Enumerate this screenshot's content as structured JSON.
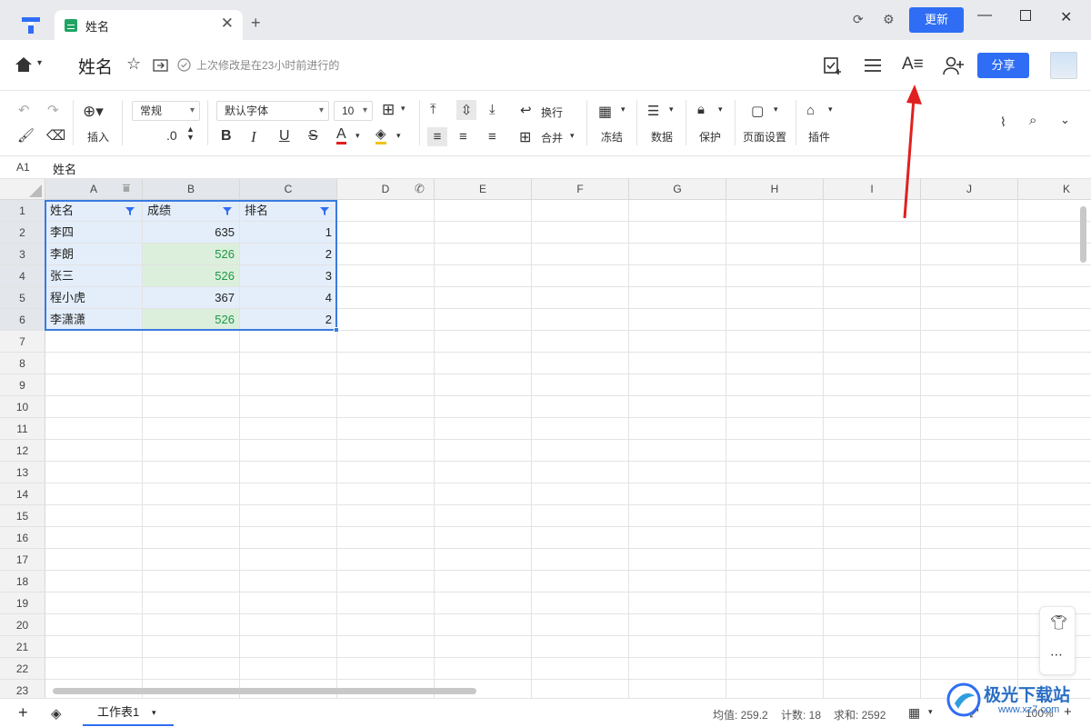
{
  "titlebar": {
    "tab_title": "姓名",
    "update_label": "更新"
  },
  "header": {
    "doc_title": "姓名",
    "save_status": "上次修改是在23小时前进行的",
    "share_label": "分享"
  },
  "toolbar": {
    "insert": "插入",
    "number_format": "常规",
    "decimal": ".0",
    "font": "默认字体",
    "size": "10",
    "bold": "B",
    "italic": "I",
    "underline": "U",
    "strike": "S",
    "fontcolor": "A",
    "wrap": "换行",
    "merge": "合并",
    "freeze": "冻结",
    "data": "数据",
    "protect": "保护",
    "page_setup": "页面设置",
    "plugin": "插件"
  },
  "formula_bar": {
    "cell_ref": "A1",
    "value": "姓名"
  },
  "columns": [
    "A",
    "B",
    "C",
    "D",
    "E",
    "F",
    "G",
    "H",
    "I",
    "J",
    "K"
  ],
  "rows": [
    "1",
    "2",
    "3",
    "4",
    "5",
    "6",
    "7",
    "8",
    "9",
    "10",
    "11",
    "12",
    "13",
    "14",
    "15",
    "16",
    "17",
    "18",
    "19",
    "20",
    "21",
    "22",
    "23"
  ],
  "table": {
    "headers": [
      "姓名",
      "成绩",
      "排名"
    ],
    "records": [
      {
        "name": "李四",
        "score": "635",
        "rank": "1"
      },
      {
        "name": "李朗",
        "score": "526",
        "rank": "2"
      },
      {
        "name": "张三",
        "score": "526",
        "rank": "3"
      },
      {
        "name": "程小虎",
        "score": "367",
        "rank": "4"
      },
      {
        "name": "李潇潇",
        "score": "526",
        "rank": "2"
      }
    ]
  },
  "colors": {
    "accent": "#2f6df5",
    "selection": "#e3eefa",
    "highlight_fill": "#dcefdc",
    "highlight_text": "#1a9a45",
    "arrow": "#e02020"
  },
  "bottom": {
    "sheet_name": "工作表1",
    "avg": "均值: 259.2",
    "count": "计数: 18",
    "sum": "求和: 2592",
    "zoom": "100%"
  },
  "watermark": {
    "text": "极光下载站",
    "url": "www.xz7.com"
  }
}
